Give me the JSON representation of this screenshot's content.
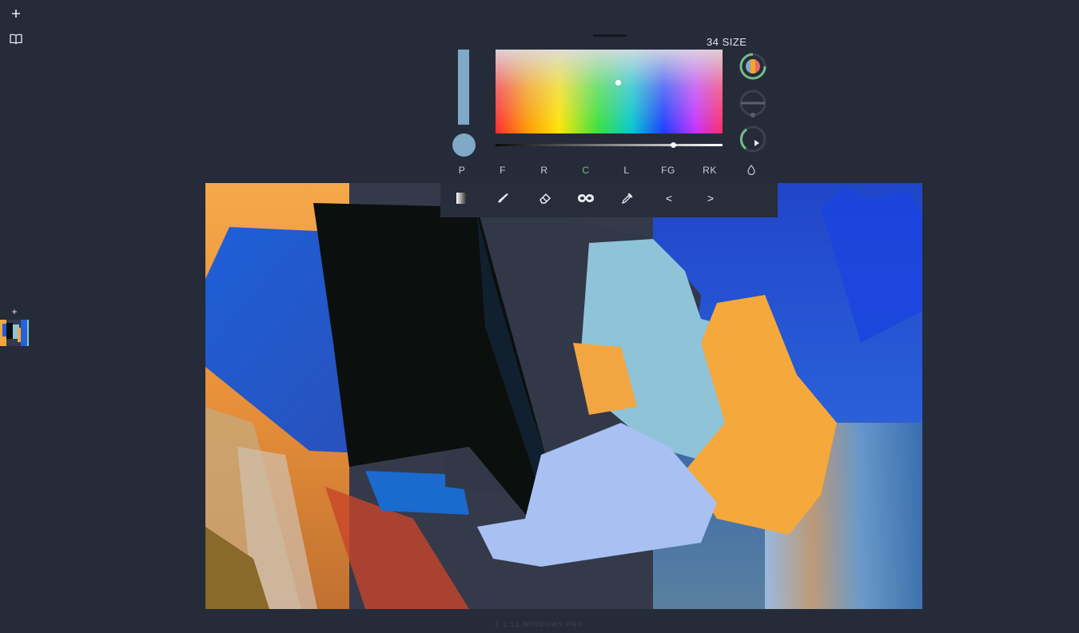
{
  "left_toolbar": {
    "add_icon": "plus-icon",
    "library_icon": "book-icon"
  },
  "brush": {
    "size_label": "34 SIZE",
    "color_hex": "#7fa9c7"
  },
  "tabs": [
    {
      "label": "P"
    },
    {
      "label": "F"
    },
    {
      "label": "R"
    },
    {
      "label": "C",
      "active": true
    },
    {
      "label": "L"
    },
    {
      "label": "FG"
    },
    {
      "label": "RK"
    },
    {
      "label": "",
      "icon": "droplet-icon"
    }
  ],
  "tools": {
    "gradient": "gradient-icon",
    "brush": "brush-icon",
    "eraser": "eraser-icon",
    "mask": "mask-icon",
    "eyedropper": "eyedropper-icon",
    "prev_label": "<",
    "next_label": ">"
  },
  "layers": {
    "add_label": "+"
  },
  "colors": {
    "accent_green": "#6fbf83",
    "background": "#262b3a"
  },
  "footer": {
    "version": "2.1.12 WINDOWS PRO"
  }
}
